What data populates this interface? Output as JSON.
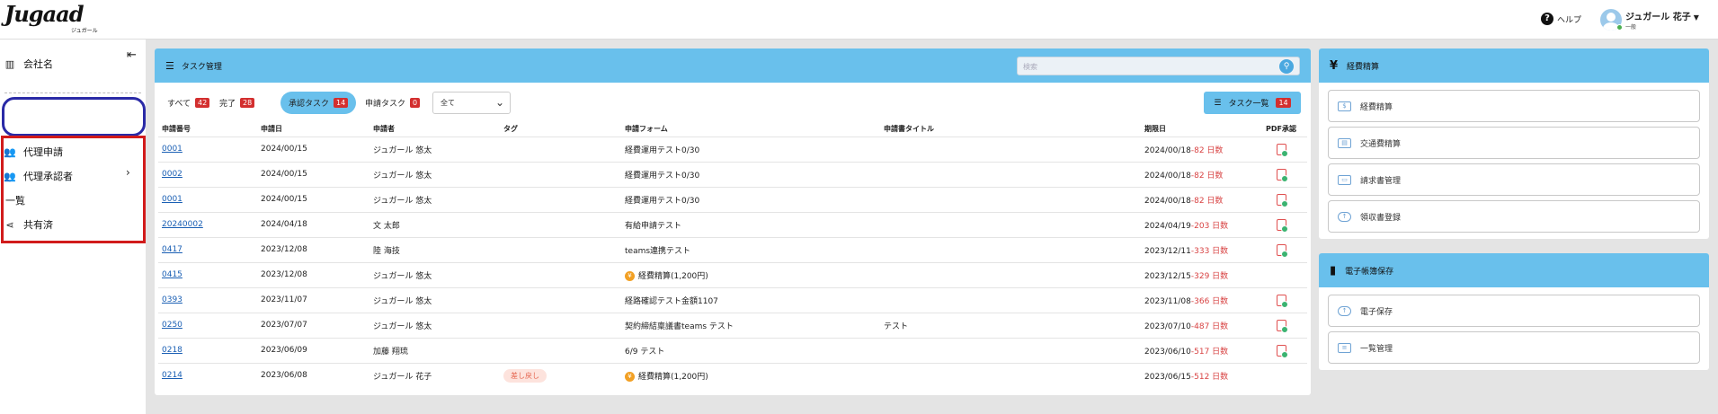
{
  "header": {
    "logo": "Jugaad",
    "logo_sub": "ジュガール",
    "help_label": "ヘルプ",
    "user_name": "ジュガール 花子",
    "user_role": "一般"
  },
  "sidebar": {
    "items": [
      {
        "label": "会社名",
        "icon": "building-icon"
      },
      {
        "label": "代理申請",
        "icon": "users-icon"
      },
      {
        "label": "代理承認者",
        "icon": "users-icon"
      },
      {
        "label": "一覧",
        "icon": ""
      },
      {
        "label": "共有済",
        "icon": "share-icon"
      }
    ]
  },
  "task_panel": {
    "title": "タスク管理",
    "search_placeholder": "検索",
    "tabs": [
      {
        "label": "すべて",
        "count": "42"
      },
      {
        "label": "完了",
        "count": "28"
      },
      {
        "label": "承認タスク",
        "count": "14"
      },
      {
        "label": "申請タスク",
        "count": "0"
      }
    ],
    "select_value": "全て",
    "tasklist_button": "タスク一覧",
    "tasklist_count": "14",
    "columns": [
      "申請番号",
      "申請日",
      "申請者",
      "タグ",
      "申請フォーム",
      "申請書タイトル",
      "期限日",
      "PDF承認"
    ],
    "rows": [
      {
        "id": "0001",
        "date": "2024/00/15",
        "applicant": "ジュガール 悠太",
        "tag": "",
        "form": "経費運用テスト0/30",
        "coin": false,
        "title": "",
        "deadline": "2024/00/18",
        "days": "-82 日数",
        "pdf": true
      },
      {
        "id": "0002",
        "date": "2024/00/15",
        "applicant": "ジュガール 悠太",
        "tag": "",
        "form": "経費運用テスト0/30",
        "coin": false,
        "title": "",
        "deadline": "2024/00/18",
        "days": "-82 日数",
        "pdf": true
      },
      {
        "id": "0001",
        "date": "2024/00/15",
        "applicant": "ジュガール 悠太",
        "tag": "",
        "form": "経費運用テスト0/30",
        "coin": false,
        "title": "",
        "deadline": "2024/00/18",
        "days": "-82 日数",
        "pdf": true
      },
      {
        "id": "20240002",
        "date": "2024/04/18",
        "applicant": "文 太郎",
        "tag": "",
        "form": "有給申請テスト",
        "coin": false,
        "title": "",
        "deadline": "2024/04/19",
        "days": "-203 日数",
        "pdf": true
      },
      {
        "id": "0417",
        "date": "2023/12/08",
        "applicant": "陸 海技",
        "tag": "",
        "form": "teams連携テスト",
        "coin": false,
        "title": "",
        "deadline": "2023/12/11",
        "days": "-333 日数",
        "pdf": true
      },
      {
        "id": "0415",
        "date": "2023/12/08",
        "applicant": "ジュガール 悠太",
        "tag": "",
        "form": "経費精算(1,200円)",
        "coin": true,
        "title": "",
        "deadline": "2023/12/15",
        "days": "-329 日数",
        "pdf": false
      },
      {
        "id": "0393",
        "date": "2023/11/07",
        "applicant": "ジュガール 悠太",
        "tag": "",
        "form": "経路確認テスト金額1107",
        "coin": false,
        "title": "",
        "deadline": "2023/11/08",
        "days": "-366 日数",
        "pdf": true
      },
      {
        "id": "0250",
        "date": "2023/07/07",
        "applicant": "ジュガール 悠太",
        "tag": "",
        "form": "契約締結稟議書teams テスト",
        "coin": false,
        "title": "テスト",
        "deadline": "2023/07/10",
        "days": "-487 日数",
        "pdf": true
      },
      {
        "id": "0218",
        "date": "2023/06/09",
        "applicant": "加藤 翔琉",
        "tag": "",
        "form": "6/9 テスト",
        "coin": false,
        "title": "",
        "deadline": "2023/06/10",
        "days": "-517 日数",
        "pdf": true
      },
      {
        "id": "0214",
        "date": "2023/06/08",
        "applicant": "ジュガール 花子",
        "tag": "差し戻し",
        "form": "経費精算(1,200円)",
        "coin": true,
        "title": "",
        "deadline": "2023/06/15",
        "days": "-512 日数",
        "pdf": false
      }
    ]
  },
  "expense_panel": {
    "title": "経費精算",
    "items": [
      {
        "label": "経費精算",
        "icon": "money-icon"
      },
      {
        "label": "交通費精算",
        "icon": "train-icon"
      },
      {
        "label": "請求書管理",
        "icon": "card-icon"
      },
      {
        "label": "領収書登録",
        "icon": "cloud-upload-icon"
      }
    ]
  },
  "ebook_panel": {
    "title": "電子帳簿保存",
    "items": [
      {
        "label": "電子保存",
        "icon": "cloud-upload-icon"
      },
      {
        "label": "一覧管理",
        "icon": "list-copy-icon"
      }
    ]
  },
  "colors": {
    "accent": "#69c0ec",
    "badge": "#d32f2f",
    "deadline": "#d84343",
    "annotation_blue": "#2a2aa6",
    "annotation_red": "#d11b1b"
  }
}
